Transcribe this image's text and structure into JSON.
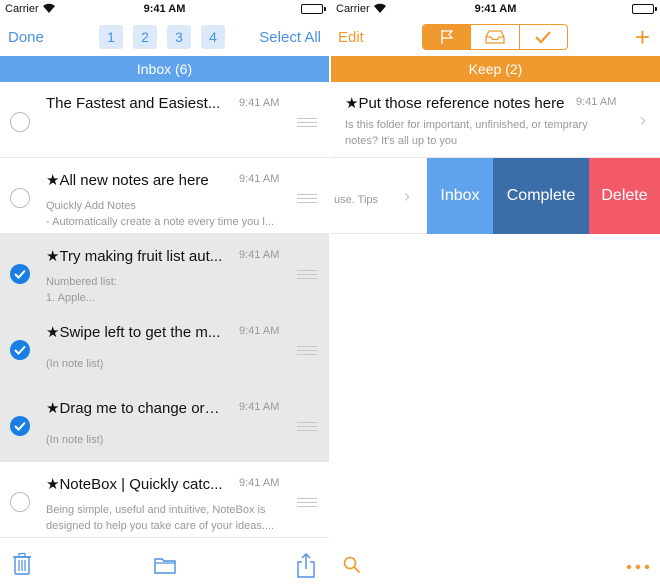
{
  "status": {
    "carrier": "Carrier",
    "time": "9:41 AM"
  },
  "left": {
    "nav": {
      "done": "Done",
      "pages": [
        "1",
        "2",
        "3",
        "4"
      ],
      "select_all": "Select All"
    },
    "section": "Inbox (6)",
    "notes": [
      {
        "title": "The Fastest and Easiest...",
        "time": "9:41 AM",
        "preview": "",
        "selected": false
      },
      {
        "title": "★All new notes are here",
        "time": "9:41 AM",
        "preview": "Quickly Add Notes\n- Automatically create a note every time you l...",
        "selected": false
      },
      {
        "title": "★Try making fruit list aut...",
        "time": "9:41 AM",
        "preview": "Numbered list:\n1. Apple...",
        "selected": true
      },
      {
        "title": "★Swipe left to get the m...",
        "time": "9:41 AM",
        "preview": "(In note list)",
        "selected": true
      },
      {
        "title": "★Drag me to change order",
        "time": "9:41 AM",
        "preview": "(In note list)",
        "selected": true
      },
      {
        "title": "★NoteBox | Quickly catc...",
        "time": "9:41 AM",
        "preview": "Being simple, useful and intuitive, NoteBox is\ndesigned to help you take care of your ideas....",
        "selected": false
      }
    ],
    "toolbar": {
      "icons": [
        "trash-icon",
        "folder-icon",
        "share-icon"
      ]
    }
  },
  "right": {
    "nav": {
      "edit": "Edit",
      "plus": "+",
      "segments": [
        "flag-icon",
        "inbox-tray-icon",
        "checkmark-icon"
      ]
    },
    "section": "Keep (2)",
    "notes": [
      {
        "title": "★Put those reference notes here",
        "time": "9:41 AM",
        "preview": "Is this folder for important, unfinished, or temprary\nnotes? It's all up to you"
      }
    ],
    "swipe_row": {
      "peek": "use. Tips",
      "actions": {
        "inbox": "Inbox",
        "complete": "Complete",
        "delete": "Delete"
      }
    },
    "toolbar": {
      "icons": [
        "search-icon",
        "more-icon"
      ]
    }
  },
  "colors": {
    "blue_accent": "#5ea3ec",
    "orange_accent": "#f0992f",
    "check_blue": "#1a7fe3",
    "delete_red": "#f25a6a",
    "complete_navy": "#3b6ea8"
  }
}
